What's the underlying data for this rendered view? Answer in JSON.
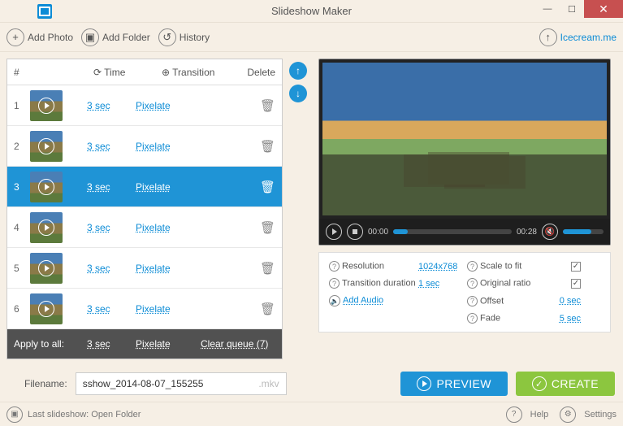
{
  "window": {
    "title": "Slideshow Maker"
  },
  "toolbar": {
    "add_photo": "Add Photo",
    "add_folder": "Add Folder",
    "history": "History",
    "brand": "Icecream.me"
  },
  "list": {
    "headers": {
      "num": "#",
      "time": "Time",
      "transition": "Transition",
      "delete": "Delete"
    },
    "rows": [
      {
        "n": "1",
        "time": "3 sec",
        "transition": "Pixelate",
        "selected": false
      },
      {
        "n": "2",
        "time": "3 sec",
        "transition": "Pixelate",
        "selected": false
      },
      {
        "n": "3",
        "time": "3 sec",
        "transition": "Pixelate",
        "selected": true
      },
      {
        "n": "4",
        "time": "3 sec",
        "transition": "Pixelate",
        "selected": false
      },
      {
        "n": "5",
        "time": "3 sec",
        "transition": "Pixelate",
        "selected": false
      },
      {
        "n": "6",
        "time": "3 sec",
        "transition": "Pixelate",
        "selected": false
      }
    ],
    "apply_all": {
      "label": "Apply to all:",
      "time": "3 sec",
      "transition": "Pixelate",
      "clear": "Clear queue (7)"
    }
  },
  "player": {
    "cur": "00:00",
    "dur": "00:28"
  },
  "settings": {
    "resolution_lbl": "Resolution",
    "resolution_val": "1024x768",
    "tdur_lbl": "Transition duration",
    "tdur_val": "1 sec",
    "scale_lbl": "Scale to fit",
    "scale_checked": true,
    "orig_lbl": "Original ratio",
    "orig_checked": true,
    "offset_lbl": "Offset",
    "offset_val": "0 sec",
    "fade_lbl": "Fade",
    "fade_val": "5 sec",
    "add_audio": "Add Audio"
  },
  "filebar": {
    "label": "Filename:",
    "value": "sshow_2014-08-07_155255",
    "ext": ".mkv"
  },
  "buttons": {
    "preview": "PREVIEW",
    "create": "CREATE"
  },
  "footer": {
    "last": "Last slideshow: Open Folder",
    "help": "Help",
    "settings": "Settings"
  }
}
